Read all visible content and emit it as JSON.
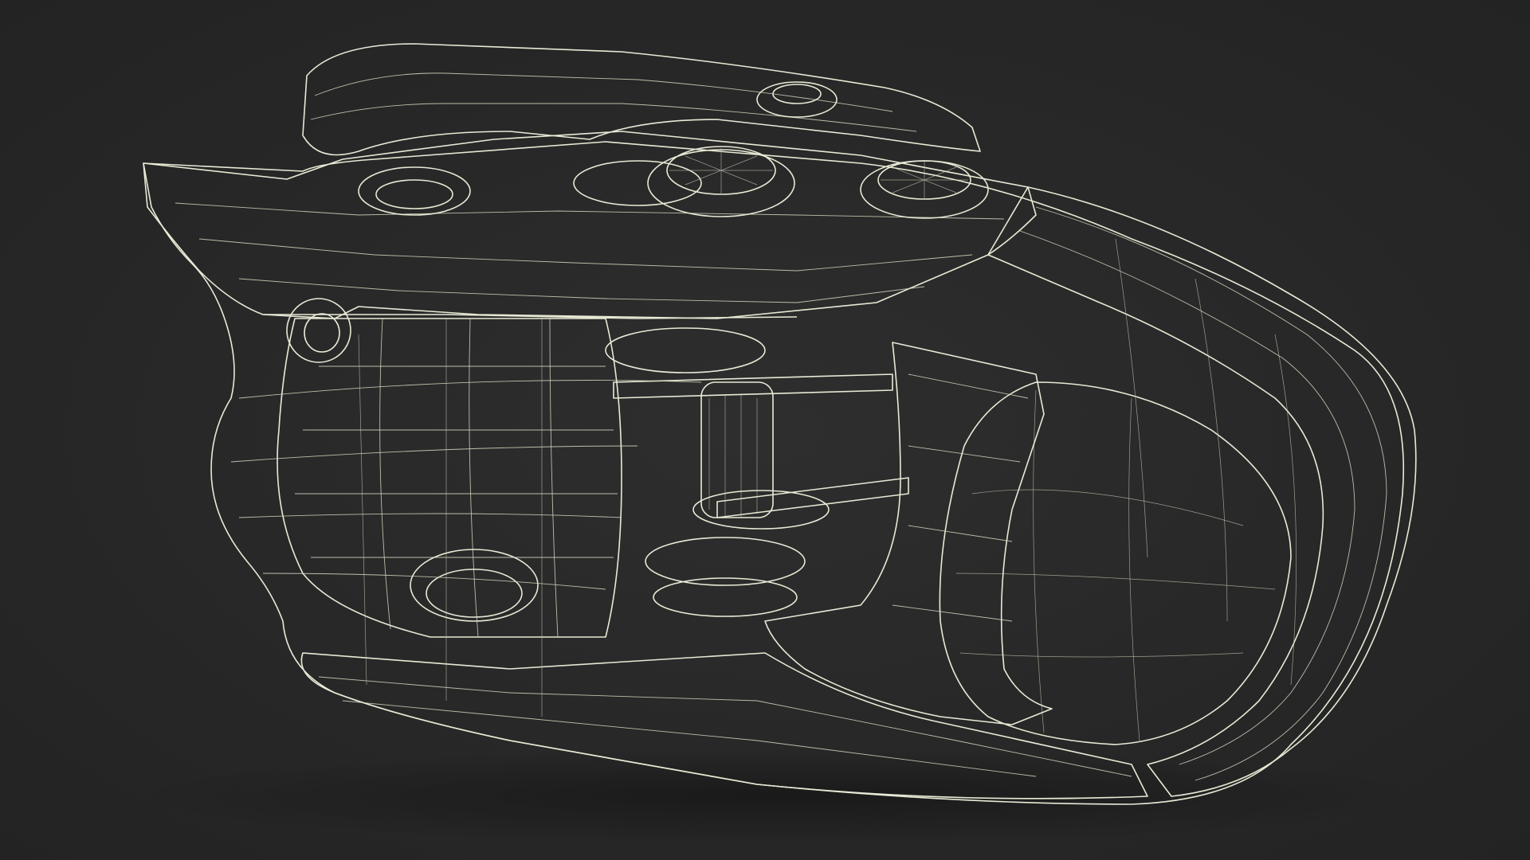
{
  "scene": {
    "subject": "wireframe-3d-model",
    "background_color": "#262626",
    "mesh_fill_light": "#7b7c70",
    "mesh_fill_mid": "#6a6b60",
    "mesh_fill_dark": "#4c4d45",
    "mesh_fill_shadow": "#3a3b35",
    "wire_color": "#e6e6d2"
  }
}
